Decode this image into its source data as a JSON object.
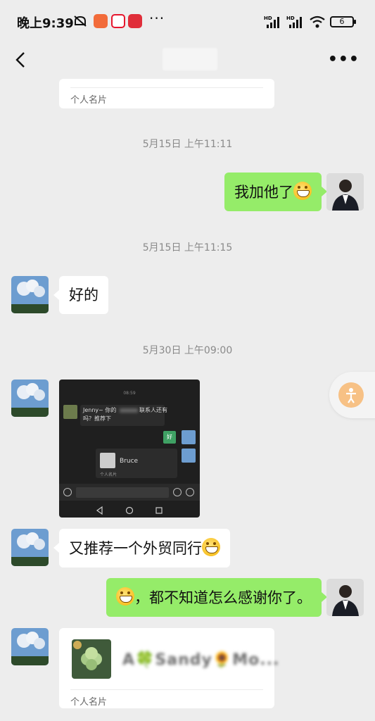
{
  "status_bar": {
    "time": "晚上9:39",
    "more": "···",
    "network_1": "HD",
    "network_2": "HD",
    "battery": "6"
  },
  "nav": {
    "more": "•••"
  },
  "messages": {
    "card_top_label": "个人名片",
    "ts1": "5月15日 上午11:11",
    "msg1": "我加他了",
    "ts2": "5月15日 上午11:15",
    "msg2": "好的",
    "ts3": "5月30日 上午09:00",
    "image": {
      "time": "08:59",
      "line1": "Jenny~ 你的",
      "line1b": "联系人还有",
      "line2": "吗？推荐下",
      "reply": "好",
      "card_name": "Bruce",
      "card_label": "个人名片"
    },
    "msg3": "又推荐一个外贸同行",
    "msg4": "，都不知道怎么感谢你了。",
    "card_bottom_name": "A🍀Sandy🌻Mo...",
    "card_bottom_label": "个人名片"
  },
  "colors": {
    "background": "#ededed",
    "green_bubble": "#95ec69",
    "white_bubble": "#ffffff",
    "timestamp": "#8a8a8a"
  }
}
